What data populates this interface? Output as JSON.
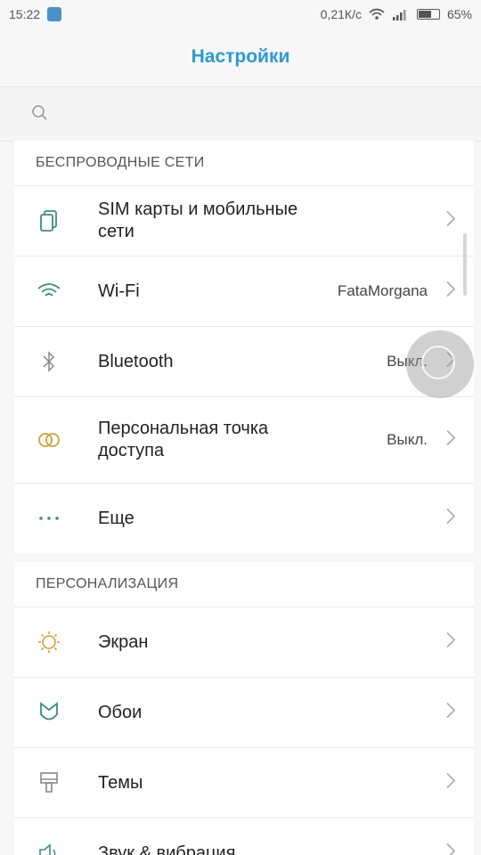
{
  "status_bar": {
    "time": "15:22",
    "network_speed": "0,21К/с",
    "battery_percent": "65%",
    "battery_level": 0.65
  },
  "header": {
    "title": "Настройки"
  },
  "search": {
    "placeholder": ""
  },
  "sections": [
    {
      "title": "БЕСПРОВОДНЫЕ СЕТИ",
      "items": [
        {
          "label": "SIM карты и мобильные сети",
          "value": "",
          "icon": "sim-cards-icon"
        },
        {
          "label": "Wi-Fi",
          "value": "FataMorgana",
          "icon": "wifi-icon"
        },
        {
          "label": "Bluetooth",
          "value": "Выкл.",
          "icon": "bluetooth-icon"
        },
        {
          "label": "Персональная точка доступа",
          "value": "Выкл.",
          "icon": "hotspot-icon"
        },
        {
          "label": "Еще",
          "value": "",
          "icon": "more-dots-icon"
        }
      ]
    },
    {
      "title": "ПЕРСОНАЛИЗАЦИЯ",
      "items": [
        {
          "label": "Экран",
          "value": "",
          "icon": "brightness-icon"
        },
        {
          "label": "Обои",
          "value": "",
          "icon": "wallpaper-icon"
        },
        {
          "label": "Темы",
          "value": "",
          "icon": "themes-icon"
        },
        {
          "label": "Звук & вибрация",
          "value": "",
          "icon": "sound-icon"
        }
      ]
    }
  ],
  "colors": {
    "accent": "#2c9ad4",
    "icon_teal": "#3a8f7a",
    "icon_gold": "#c9a437"
  }
}
